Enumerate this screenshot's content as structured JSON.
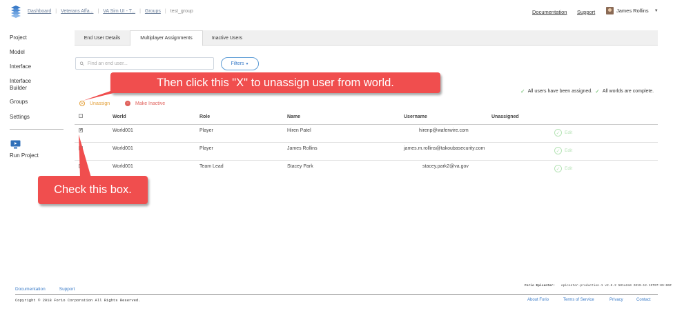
{
  "header": {
    "breadcrumbs": [
      "Dashboard",
      "Veterans Affa...",
      "VA Sim UI - T...",
      "Groups",
      "test_group"
    ],
    "documentation": "Documentation",
    "support": "Support",
    "user_name": "James Rollins"
  },
  "sidebar": {
    "items": [
      "Project",
      "Model",
      "Interface",
      "Interface Builder",
      "Groups",
      "Settings"
    ],
    "run_project": "Run Project"
  },
  "tabs": [
    "End User Details",
    "Multiplayer Assignments",
    "Inactive Users"
  ],
  "active_tab": "Multiplayer Assignments",
  "search": {
    "placeholder": "Find an end user..."
  },
  "filters_label": "Filters",
  "status": {
    "users": "All users have been assigned.",
    "worlds": "All worlds are complete."
  },
  "actions": {
    "unassign": "Unassign",
    "make_inactive": "Make Inactive"
  },
  "table": {
    "headers": [
      "World",
      "Role",
      "Name",
      "Username",
      "Unassigned"
    ],
    "rows": [
      {
        "checked": true,
        "world": "World001",
        "role": "Player",
        "name": "Hiren Patel",
        "username": "hirenp@waferwire.com",
        "edit": "Edit"
      },
      {
        "checked": false,
        "world": "World001",
        "role": "Player",
        "name": "James Rollins",
        "username": "james.m.rollins@takoubasecurity.com",
        "edit": "Edit"
      },
      {
        "checked": false,
        "world": "World001",
        "role": "Team Lead",
        "name": "Stacey Park",
        "username": "stacey.park2@va.gov",
        "edit": "Edit"
      }
    ]
  },
  "callouts": {
    "unassign_tip": "Then click this \"X\" to unassign user from world.",
    "checkbox_tip": "Check this box."
  },
  "footer": {
    "links_top": [
      "Documentation",
      "Support"
    ],
    "epicenter_label": "Forio Epicenter:",
    "epicenter_version": "epicenter-production-1 v2.6.2 501a2a9 2019-12-15T07:09:00Z",
    "copyright": "Copyright © 2018 Forio Corporation All Rights Reserved.",
    "links_bottom": [
      "About Forio",
      "Terms of Service",
      "Privacy",
      "Contact"
    ]
  },
  "colors": {
    "callout": "#f04e4e",
    "accent": "#3a7bc8",
    "success": "#5cb85c",
    "unassign": "#e3a03a",
    "inactive": "#e0605a"
  }
}
